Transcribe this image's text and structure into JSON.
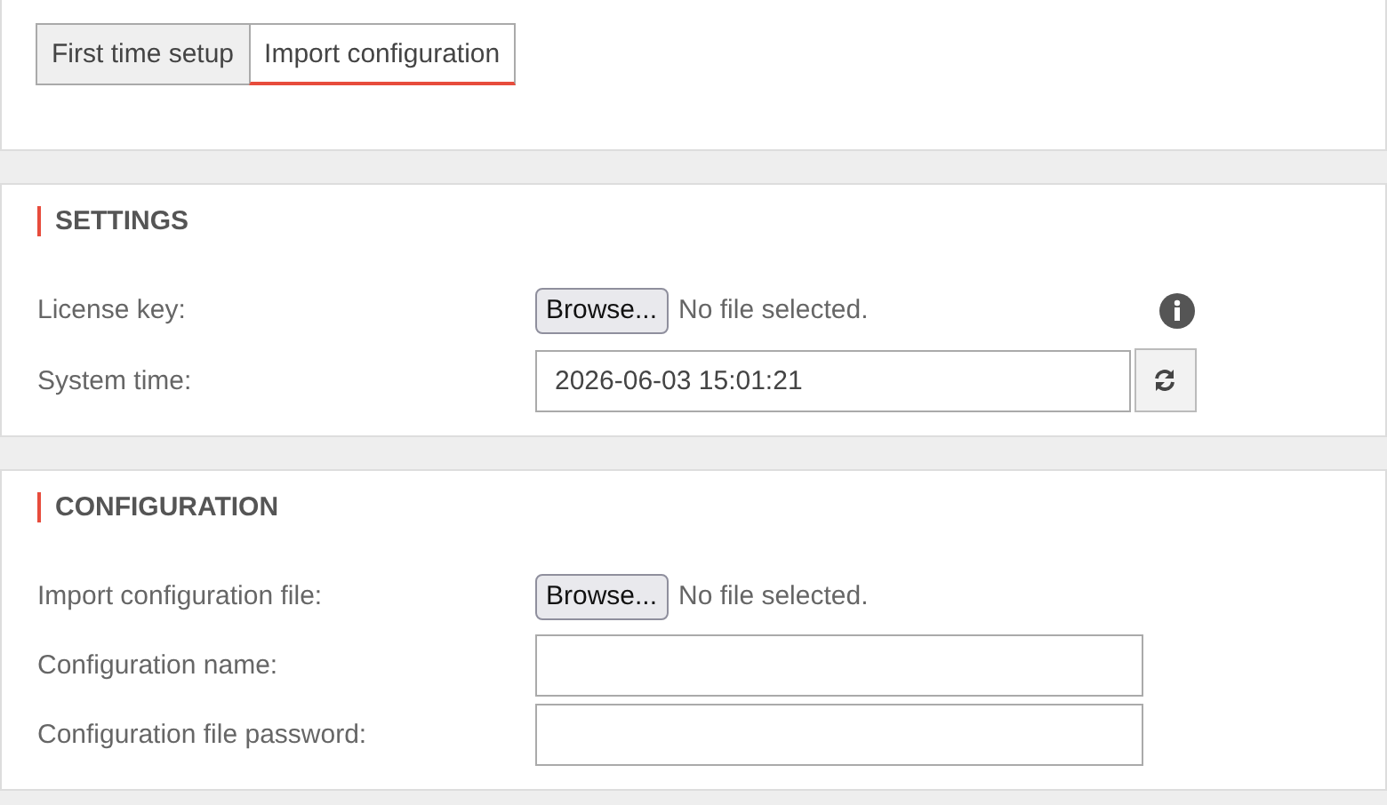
{
  "tabs": [
    {
      "label": "First time setup",
      "selected": false
    },
    {
      "label": "Import configuration",
      "selected": true
    }
  ],
  "sections": [
    {
      "title": "SETTINGS",
      "rows": [
        {
          "kind": "file",
          "label": "License key:",
          "button": "Browse...",
          "status": "No file selected.",
          "info": true
        },
        {
          "kind": "time",
          "label": "System time:",
          "value": "2026-06-03 15:01:21"
        }
      ]
    },
    {
      "title": "CONFIGURATION",
      "rows": [
        {
          "kind": "file",
          "label": "Import configuration file:",
          "button": "Browse...",
          "status": "No file selected.",
          "info": false
        },
        {
          "kind": "input",
          "label": "Configuration name:"
        },
        {
          "kind": "input",
          "label": "Configuration file password:"
        }
      ]
    }
  ]
}
